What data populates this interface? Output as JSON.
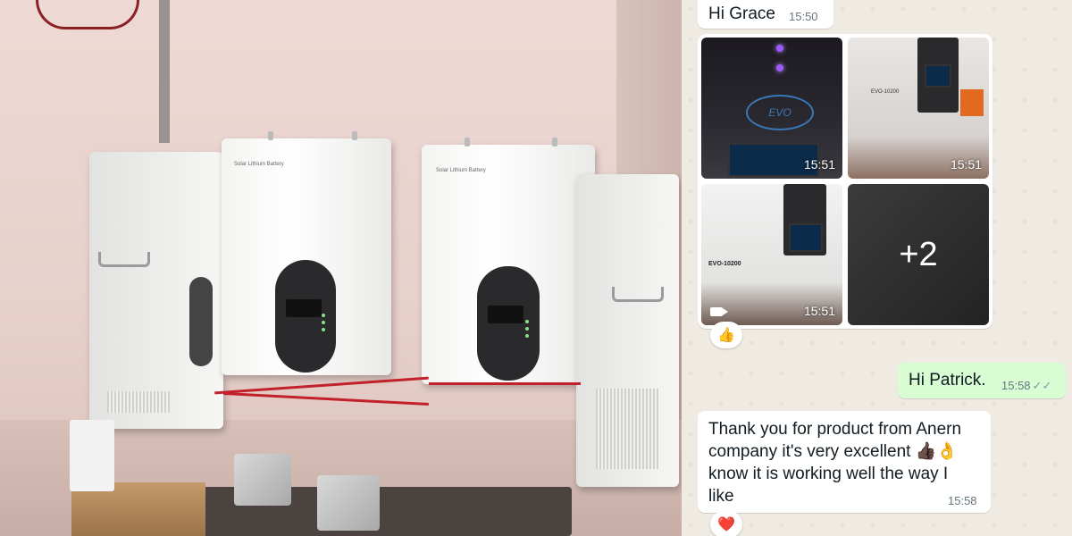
{
  "photo": {
    "battery_label": "Solar Lithium Battery",
    "inverter_label": "EVO-10200"
  },
  "chat": {
    "messages": [
      {
        "text": "Hi Grace",
        "time": "15:50"
      },
      {
        "text": "Hi Patrick.",
        "time": "15:58"
      },
      {
        "text": "Thank you for product from Anern company  it's very excellent 👍🏿👌 know it is working well the way I like",
        "time": "15:58"
      }
    ],
    "media": {
      "tiles": [
        {
          "time": "15:51",
          "caption": "EVO"
        },
        {
          "time": "15:51",
          "caption": "EVO-10200"
        },
        {
          "time": "15:51",
          "caption": "EVO-10200"
        }
      ],
      "more_count": "+2",
      "reaction": "👍"
    },
    "heart_reaction": "❤️",
    "read_receipt": "✓✓",
    "colors": {
      "incoming": "#ffffff",
      "outgoing": "#d9fdd3",
      "background": "#efeae2"
    }
  }
}
